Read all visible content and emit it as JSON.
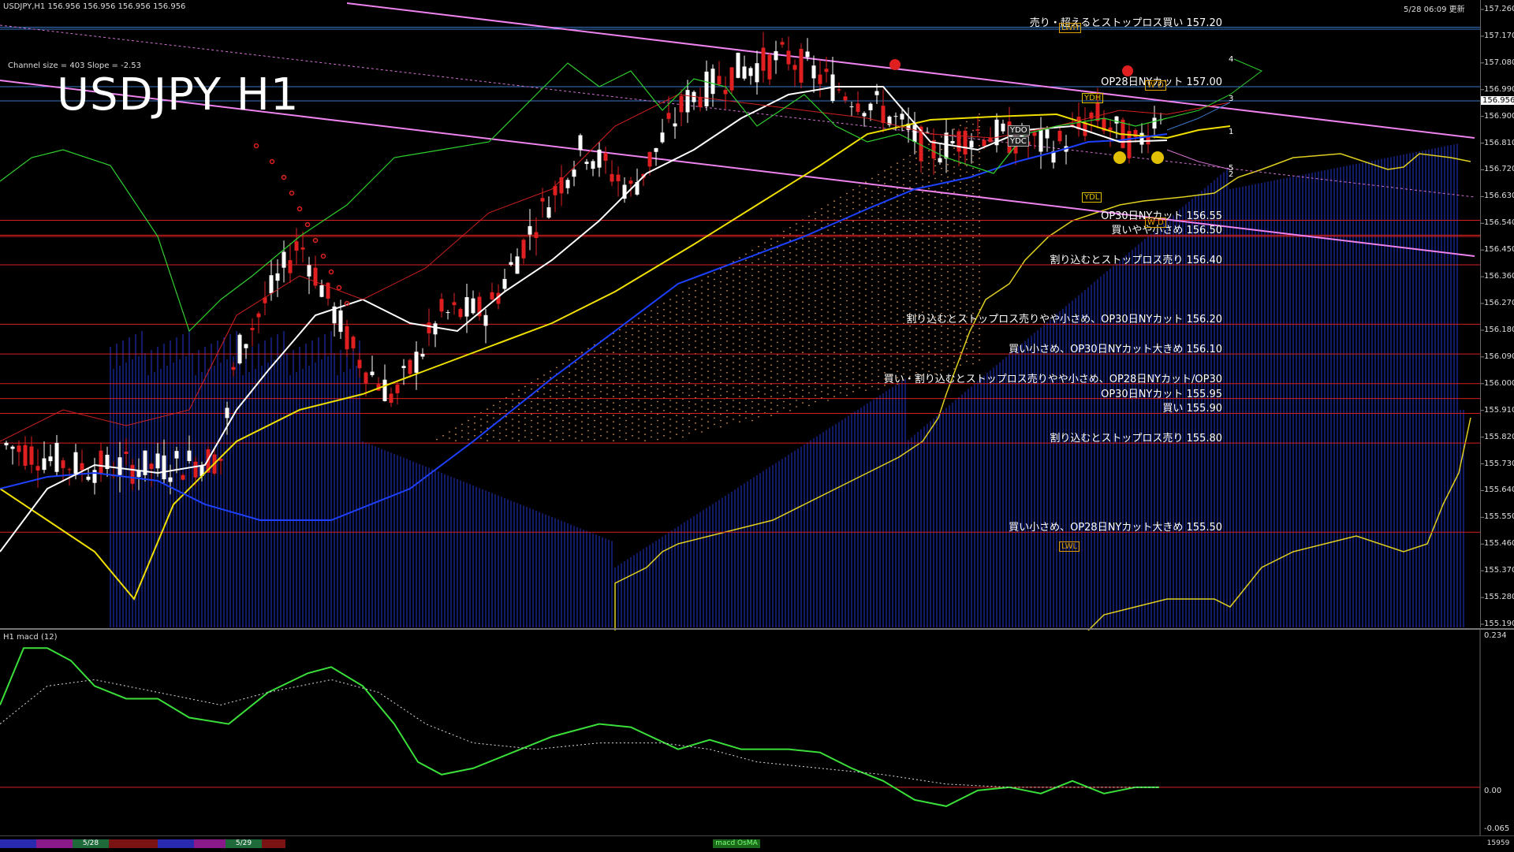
{
  "window": {
    "symbol_header": "USDJPY,H1  156.956 156.956 156.956 156.956",
    "timestamp": "5/28 06:09 更新",
    "channel_info": "Channel size = 403 Slope = -2.53",
    "chart_title": "USDJPY H1"
  },
  "price_axis": {
    "current_price": "156.956",
    "ticks": [
      "157.260",
      "157.170",
      "157.080",
      "156.990",
      "156.900",
      "156.810",
      "156.720",
      "156.630",
      "156.540",
      "156.450",
      "156.360",
      "156.270",
      "156.180",
      "156.090",
      "156.000",
      "155.910",
      "155.820",
      "155.730",
      "155.640",
      "155.550",
      "155.460",
      "155.370",
      "155.280",
      "155.190"
    ]
  },
  "levels": [
    {
      "text": "売り・超えるとストップロス買い 157.20",
      "price": 157.2,
      "color": "#3a78c8"
    },
    {
      "text": "OP28日NYカット 157.00",
      "price": 157.0,
      "color": "#3a78c8"
    },
    {
      "text": "OP30日NYカット 156.55",
      "price": 156.55,
      "color": "#d42020"
    },
    {
      "text": "買いやや小さめ 156.50",
      "price": 156.5,
      "color": "#d42020"
    },
    {
      "text": "割り込むとストップロス売り 156.40",
      "price": 156.4,
      "color": "#d42020"
    },
    {
      "text": "割り込むとストップロス売りやや小さめ、OP30日NYカット 156.20",
      "price": 156.2,
      "color": "#d42020"
    },
    {
      "text": "買い小さめ、OP30日NYカット大きめ 156.10",
      "price": 156.1,
      "color": "#d42020"
    },
    {
      "text": "買い・割り込むとストップロス売りやや小さめ、OP28日NYカット/OP30",
      "price": 156.0,
      "color": "#d42020"
    },
    {
      "text": "OP30日NYカット 155.95",
      "price": 155.95,
      "color": "#d42020"
    },
    {
      "text": "買い 155.90",
      "price": 155.9,
      "color": "#d42020"
    },
    {
      "text": "割り込むとストップロス売り 155.80",
      "price": 155.8,
      "color": "#d42020"
    },
    {
      "text": "買い小さめ、OP28日NYカット大きめ 155.50",
      "price": 155.5,
      "color": "#d42020"
    }
  ],
  "markers": {
    "lwh": "LWH",
    "ydh": "YDH",
    "ydl": "YDL",
    "lwl": "LWL",
    "ydo": "YDO",
    "ydc": "YDC",
    "wd_top": "W D",
    "wd_bottom": "W D",
    "ch_labels": [
      "4",
      "3",
      "1",
      "5",
      "2"
    ]
  },
  "macd": {
    "title": "H1  macd (12)",
    "ticks": [
      "0.234",
      "0.00",
      "-0.065"
    ]
  },
  "bottom_bar": {
    "date_labels": [
      "5/28",
      "5/29"
    ],
    "indicator_tab": "macd OsMA",
    "right_value": "15959"
  },
  "colors": {
    "background": "#000000",
    "grid_red": "#d42020",
    "grid_blue": "#3a78c8",
    "channel_pink": "#ee82ee",
    "kumo_blue": "#1f2db0",
    "bull_candle": "#ffffff",
    "bear_candle": "#e02020",
    "macd_line": "#3adf3a"
  }
}
